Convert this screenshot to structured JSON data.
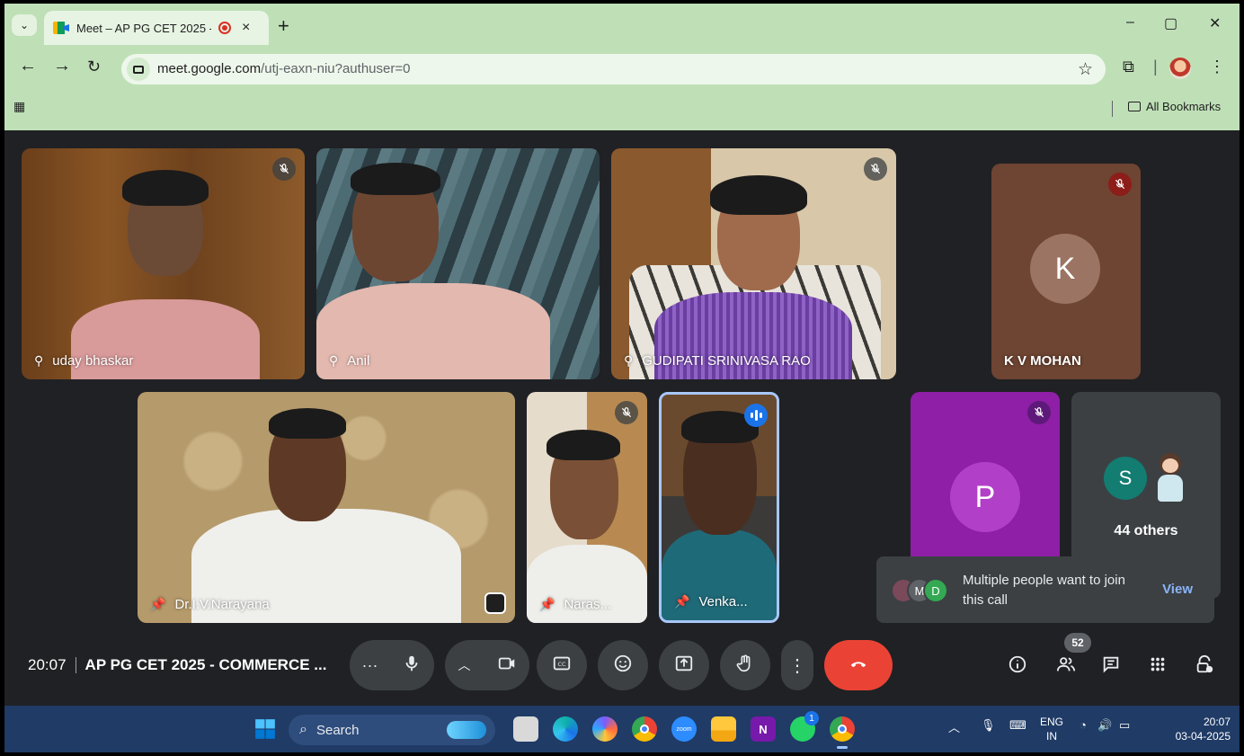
{
  "browser": {
    "tab_title": "Meet – AP PG CET 2025 - C",
    "tab_close": "×",
    "new_tab": "+",
    "url_host": "meet.google.com",
    "url_path": "/utj-eaxn-niu?authuser=0",
    "window_controls": [
      "–",
      "▢",
      "✕"
    ],
    "bookmarks_label": "All Bookmarks"
  },
  "meet": {
    "participants": [
      {
        "name": "uday bhaskar",
        "label_glyph": "pin-mic",
        "muted": true
      },
      {
        "name": "Anil",
        "label_glyph": "pin-mic",
        "muted": false
      },
      {
        "name": "GUDIPATI SRINIVASA RAO",
        "label_glyph": "pin-mic",
        "muted": true
      },
      {
        "name": "K V MOHAN",
        "avatar_letter": "K",
        "muted": true,
        "avatar_bg": "#6e4432",
        "circle_color": "#9b7463"
      },
      {
        "name": "Dr.I.V.Narayana",
        "label_glyph": "pin",
        "muted": false
      },
      {
        "name": "Naras...",
        "label_glyph": "pin",
        "muted": true
      },
      {
        "name": "Venka...",
        "label_glyph": "pin",
        "speaking": true
      },
      {
        "name": "",
        "avatar_letter": "P",
        "muted": true,
        "avatar_bg": "#8e1fa6",
        "circle_color": "#b23fc8"
      }
    ],
    "others": {
      "label": "44 others",
      "avatar_letter": "S",
      "avatar_color": "#137d72"
    },
    "join_toast": {
      "message": "Multiple people want to join this call",
      "action": "View",
      "avatars": [
        "M",
        "D"
      ]
    },
    "meeting_time": "20:07",
    "meeting_title": "AP PG CET 2025 - COMMERCE ...",
    "people_count": "52",
    "colors": {
      "end_call": "#ea4335",
      "speaking": "#1a73e8"
    }
  },
  "taskbar": {
    "search_placeholder": "Search",
    "language": "ENG",
    "region": "IN",
    "time": "20:07",
    "date": "03-04-2025",
    "whatsapp_badge": "1"
  }
}
